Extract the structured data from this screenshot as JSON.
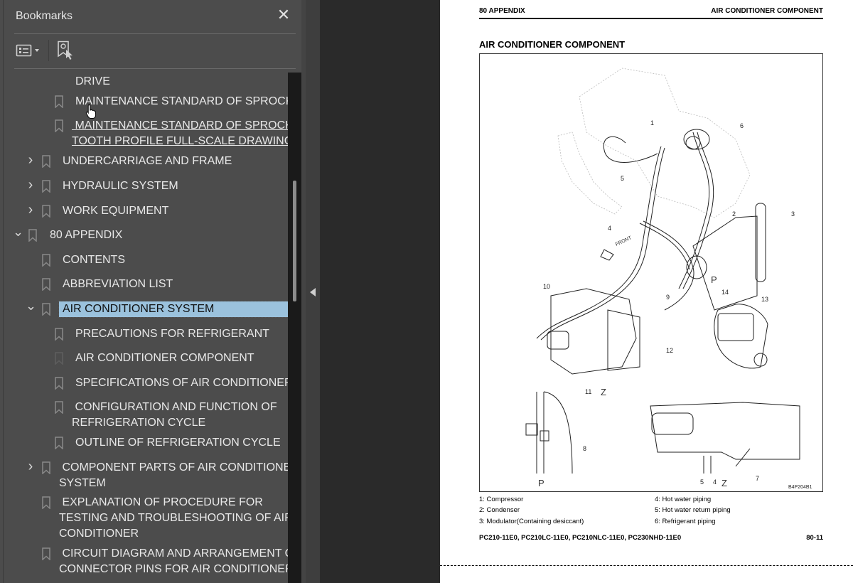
{
  "panel": {
    "title": "Bookmarks",
    "close_icon": "close-icon",
    "tools": {
      "options_icon": "list-options-icon",
      "find_icon": "find-bookmark-icon"
    }
  },
  "bookmarks": [
    {
      "label": "DRIVE",
      "level": 3,
      "chevron": "none",
      "bookmark_icon": false,
      "underline": false,
      "selected": false
    },
    {
      "label": "MAINTENANCE STANDARD OF SPROCKET",
      "level": 3,
      "chevron": "none",
      "bookmark_icon": true,
      "underline": false,
      "selected": false
    },
    {
      "label": "MAINTENANCE STANDARD OF SPROCKET\nTOOTH PROFILE FULL-SCALE DRAWING",
      "level": 3,
      "chevron": "none",
      "bookmark_icon": true,
      "underline": true,
      "selected": false
    },
    {
      "label": "UNDERCARRIAGE AND FRAME",
      "level": 2,
      "chevron": "collapsed",
      "bookmark_icon": true,
      "underline": false,
      "selected": false
    },
    {
      "label": "HYDRAULIC SYSTEM",
      "level": 2,
      "chevron": "collapsed",
      "bookmark_icon": true,
      "underline": false,
      "selected": false
    },
    {
      "label": "WORK EQUIPMENT",
      "level": 2,
      "chevron": "collapsed",
      "bookmark_icon": true,
      "underline": false,
      "selected": false
    },
    {
      "label": "80 APPENDIX",
      "level": 1,
      "chevron": "expanded",
      "bookmark_icon": true,
      "underline": false,
      "selected": false
    },
    {
      "label": "CONTENTS",
      "level": 2,
      "chevron": "none",
      "bookmark_icon": true,
      "underline": false,
      "selected": false
    },
    {
      "label": "ABBREVIATION LIST",
      "level": 2,
      "chevron": "none",
      "bookmark_icon": true,
      "underline": false,
      "selected": false
    },
    {
      "label": "AIR CONDITIONER SYSTEM",
      "level": 2,
      "chevron": "expanded",
      "bookmark_icon": true,
      "underline": false,
      "selected": true
    },
    {
      "label": "PRECAUTIONS FOR REFRIGERANT",
      "level": 3,
      "chevron": "none",
      "bookmark_icon": true,
      "underline": false,
      "selected": false
    },
    {
      "label": "AIR CONDITIONER COMPONENT",
      "level": 3,
      "chevron": "none",
      "bookmark_icon": true,
      "underline": false,
      "selected": false,
      "current": true
    },
    {
      "label": "SPECIFICATIONS OF AIR CONDITIONER",
      "level": 3,
      "chevron": "none",
      "bookmark_icon": true,
      "underline": false,
      "selected": false
    },
    {
      "label": "CONFIGURATION AND FUNCTION OF\nREFRIGERATION CYCLE",
      "level": 3,
      "chevron": "none",
      "bookmark_icon": true,
      "underline": false,
      "selected": false
    },
    {
      "label": "OUTLINE OF REFRIGERATION CYCLE",
      "level": 3,
      "chevron": "none",
      "bookmark_icon": true,
      "underline": false,
      "selected": false
    },
    {
      "label": "COMPONENT PARTS OF AIR CONDITIONER\nSYSTEM",
      "level": 2,
      "chevron": "collapsed",
      "bookmark_icon": true,
      "underline": false,
      "selected": false
    },
    {
      "label": "EXPLANATION OF PROCEDURE FOR\nTESTING AND TROUBLESHOOTING OF AIR\nCONDITIONER",
      "level": 2,
      "chevron": "none",
      "bookmark_icon": true,
      "underline": false,
      "selected": false
    },
    {
      "label": "CIRCUIT DIAGRAM AND ARRANGEMENT OF\nCONNECTOR PINS FOR AIR CONDITIONER",
      "level": 2,
      "chevron": "none",
      "bookmark_icon": true,
      "underline": false,
      "selected": false
    }
  ],
  "document": {
    "header_left": "80 APPENDIX",
    "header_right": "AIR CONDITIONER COMPONENT",
    "title": "AIR CONDITIONER COMPONENT",
    "figure": {
      "code": "B4P204B1",
      "view_labels": [
        "P",
        "Z",
        "P",
        "Z"
      ],
      "callouts": [
        "1",
        "2",
        "3",
        "4",
        "5",
        "6",
        "7",
        "8",
        "9",
        "10",
        "11",
        "12",
        "13",
        "14"
      ],
      "front_label": "FRONT"
    },
    "legend": [
      "1: Compressor",
      "2: Condenser",
      "3: Modulator(Containing desiccant)",
      "4: Hot water piping",
      "5: Hot water return piping",
      "6: Refrigerant piping"
    ],
    "footer_models": "PC210-11E0, PC210LC-11E0, PC210NLC-11E0, PC230NHD-11E0",
    "footer_page": "80-11"
  }
}
